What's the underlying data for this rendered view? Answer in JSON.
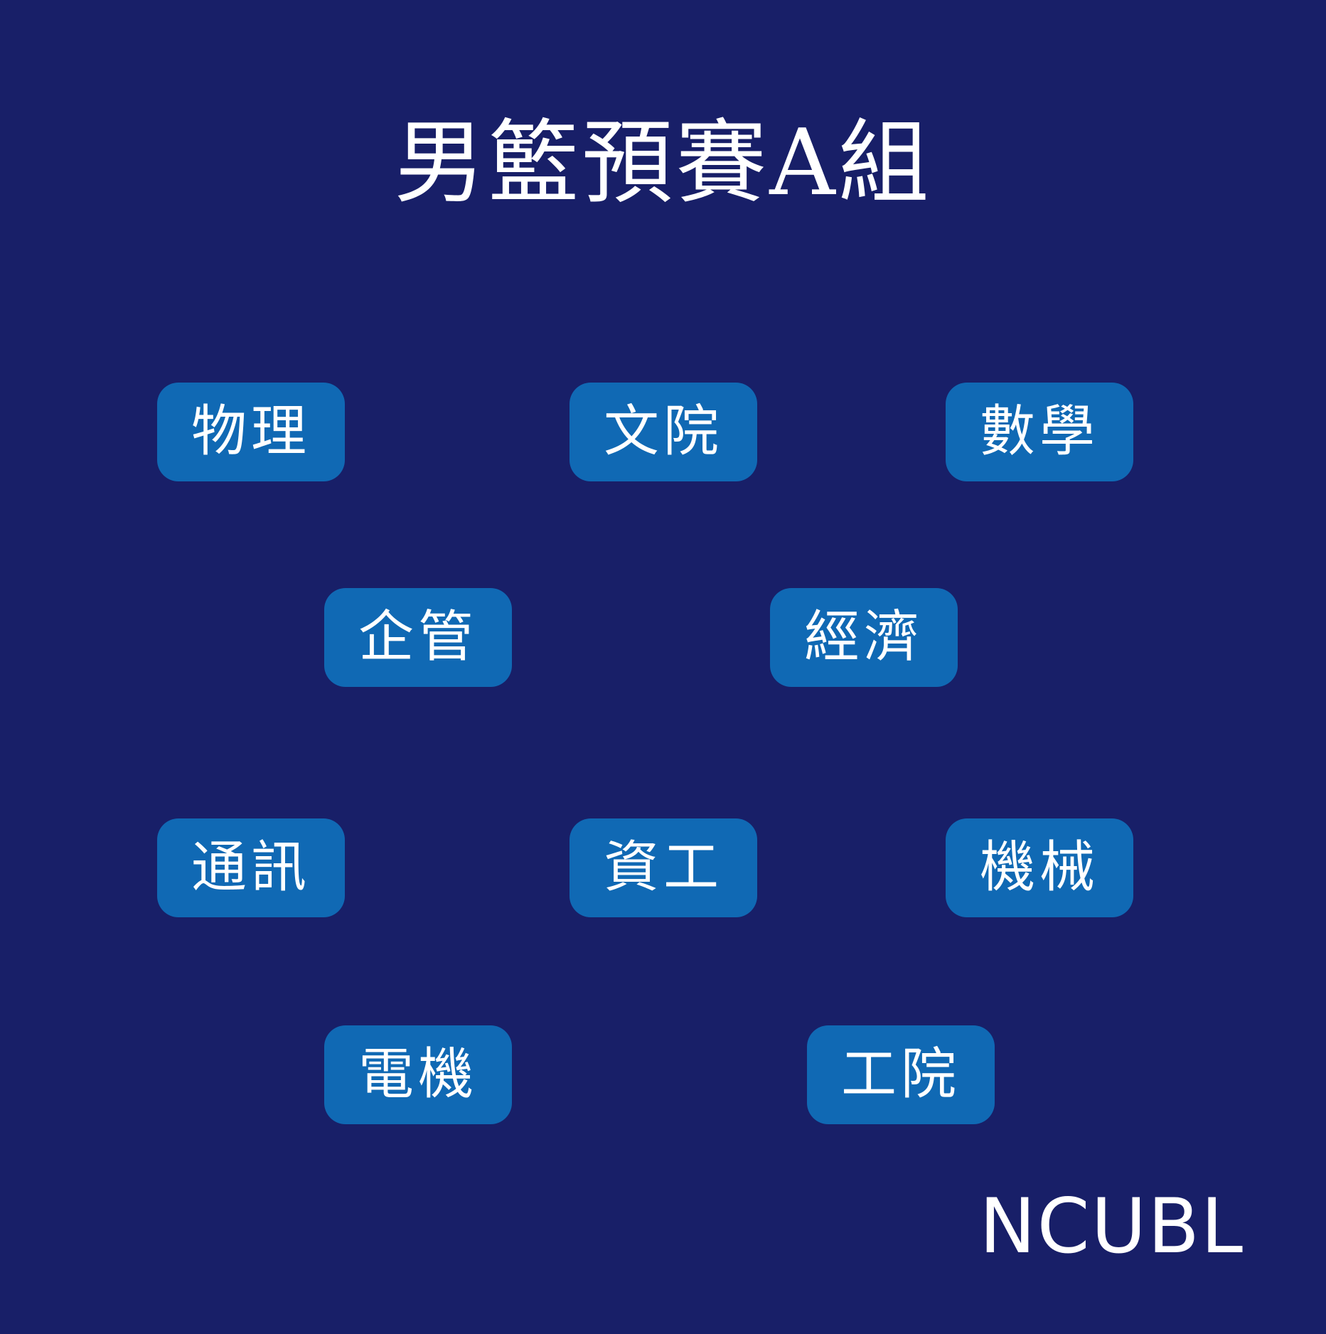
{
  "title": "男籃預賽A組",
  "teams": [
    "物理",
    "文院",
    "數學",
    "企管",
    "經濟",
    "通訊",
    "資工",
    "機械",
    "電機",
    "工院"
  ],
  "brand": "NCUBL",
  "colors": {
    "background": "#181f68",
    "team_box": "#1069b4",
    "text": "#ffffff"
  }
}
